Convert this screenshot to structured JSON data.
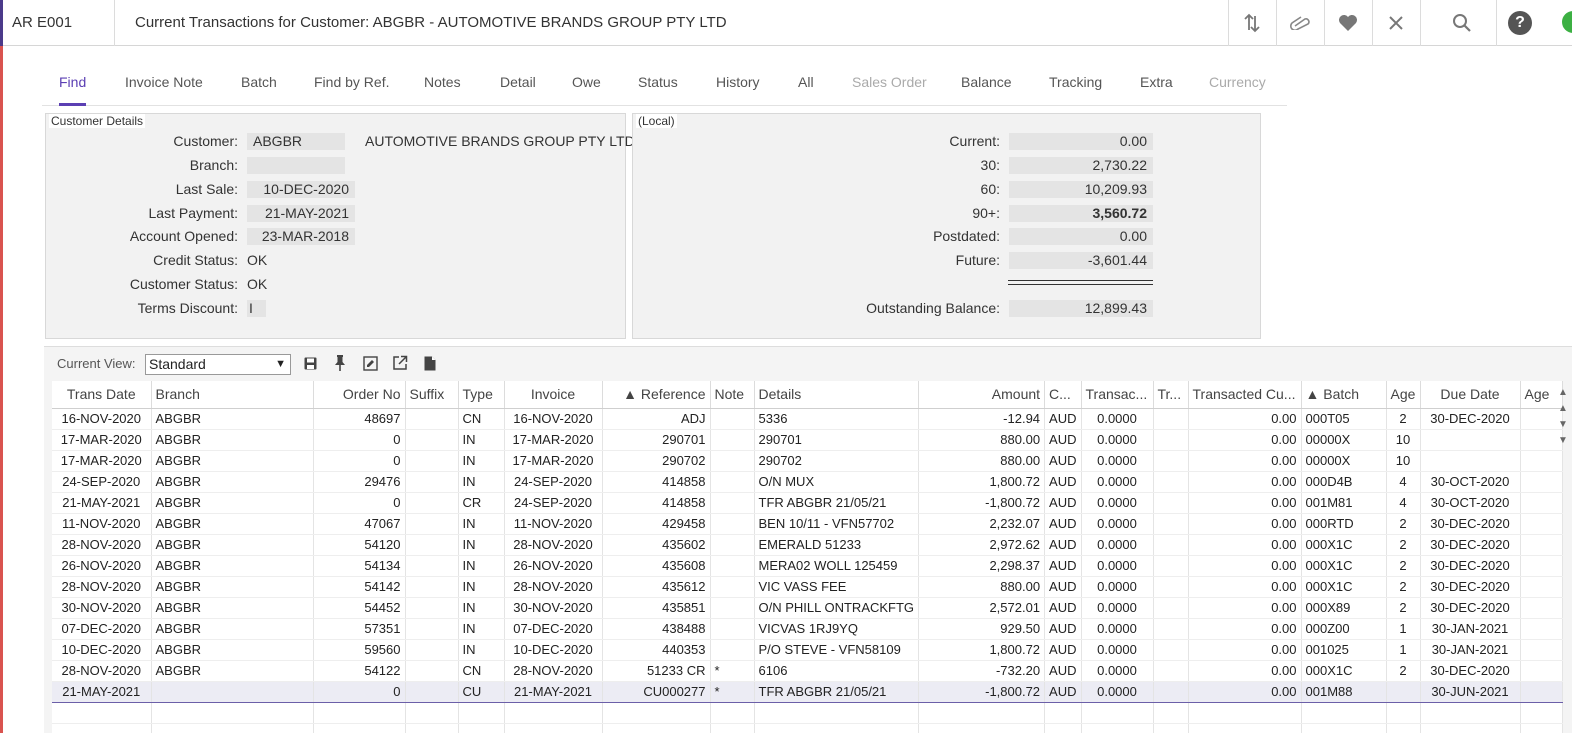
{
  "header": {
    "program_code": "AR E001",
    "title": "Current Transactions for Customer: ABGBR - AUTOMOTIVE BRANDS GROUP PTY LTD",
    "icons": [
      "sort-icon",
      "attachment-icon",
      "favorite-icon",
      "close-icon",
      "search-icon",
      "help-icon"
    ],
    "help_glyph": "?"
  },
  "tabs": [
    {
      "label": "Find",
      "state": "active"
    },
    {
      "label": "Invoice Note",
      "state": "normal"
    },
    {
      "label": "Batch",
      "state": "normal"
    },
    {
      "label": "Find by Ref.",
      "state": "normal"
    },
    {
      "label": "Notes",
      "state": "normal"
    },
    {
      "label": "Detail",
      "state": "normal"
    },
    {
      "label": "Owe",
      "state": "normal"
    },
    {
      "label": "Status",
      "state": "normal"
    },
    {
      "label": "History",
      "state": "normal"
    },
    {
      "label": "All",
      "state": "normal"
    },
    {
      "label": "Sales Order",
      "state": "disabled"
    },
    {
      "label": "Balance",
      "state": "normal"
    },
    {
      "label": "Tracking",
      "state": "normal"
    },
    {
      "label": "Extra",
      "state": "normal"
    },
    {
      "label": "Currency",
      "state": "disabled"
    }
  ],
  "customer_details": {
    "caption": "Customer Details",
    "customer_label": "Customer:",
    "customer_code": "ABGBR",
    "customer_name": "AUTOMOTIVE BRANDS GROUP PTY LTD",
    "branch_label": "Branch:",
    "branch": "",
    "last_sale_label": "Last Sale:",
    "last_sale": "10-DEC-2020",
    "last_payment_label": "Last Payment:",
    "last_payment": "21-MAY-2021",
    "account_opened_label": "Account Opened:",
    "account_opened": "23-MAR-2018",
    "credit_status_label": "Credit Status:",
    "credit_status": "OK",
    "customer_status_label": "Customer Status:",
    "customer_status": "OK",
    "terms_discount_label": "Terms Discount:",
    "terms_discount": "I"
  },
  "aging": {
    "caption": "(Local)",
    "current_label": "Current:",
    "current": "0.00",
    "d30_label": "30:",
    "d30": "2,730.22",
    "d60_label": "60:",
    "d60": "10,209.93",
    "d90_label": "90+:",
    "d90": "3,560.72",
    "postdated_label": "Postdated:",
    "postdated": "0.00",
    "future_label": "Future:",
    "future": "-3,601.44",
    "outstanding_label": "Outstanding Balance:",
    "outstanding": "12,899.43"
  },
  "view": {
    "label": "Current View:",
    "selected": "Standard",
    "tool_icons": [
      "save-icon",
      "pin-icon",
      "edit-view-icon",
      "export-icon",
      "document-icon"
    ]
  },
  "grid": {
    "columns": [
      "Trans Date",
      "Branch",
      "Order No",
      "Suffix",
      "Type",
      "Invoice",
      "▲ Reference",
      "Note",
      "Details",
      "Amount",
      "C...",
      "Transac...",
      "Tr...",
      "Transacted Cu...",
      "▲ Batch",
      "Age",
      "Due Date",
      "Age"
    ],
    "rows": [
      [
        "16-NOV-2020",
        "ABGBR",
        "48697",
        "",
        "CN",
        "16-NOV-2020",
        "ADJ",
        "",
        "5336",
        "-12.94",
        "AUD",
        "0.0000",
        "",
        "0.00",
        "000T05",
        "2",
        "30-DEC-2020",
        ""
      ],
      [
        "17-MAR-2020",
        "ABGBR",
        "0",
        "",
        "IN",
        "17-MAR-2020",
        "290701",
        "",
        "290701",
        "880.00",
        "AUD",
        "0.0000",
        "",
        "0.00",
        "00000X",
        "10",
        "",
        ""
      ],
      [
        "17-MAR-2020",
        "ABGBR",
        "0",
        "",
        "IN",
        "17-MAR-2020",
        "290702",
        "",
        "290702",
        "880.00",
        "AUD",
        "0.0000",
        "",
        "0.00",
        "00000X",
        "10",
        "",
        ""
      ],
      [
        "24-SEP-2020",
        "ABGBR",
        "29476",
        "",
        "IN",
        "24-SEP-2020",
        "414858",
        "",
        "O/N MUX",
        "1,800.72",
        "AUD",
        "0.0000",
        "",
        "0.00",
        "000D4B",
        "4",
        "30-OCT-2020",
        ""
      ],
      [
        "21-MAY-2021",
        "ABGBR",
        "0",
        "",
        "CR",
        "24-SEP-2020",
        "414858",
        "",
        "TFR ABGBR 21/05/21",
        "-1,800.72",
        "AUD",
        "0.0000",
        "",
        "0.00",
        "001M81",
        "4",
        "30-OCT-2020",
        ""
      ],
      [
        "11-NOV-2020",
        "ABGBR",
        "47067",
        "",
        "IN",
        "11-NOV-2020",
        "429458",
        "",
        "BEN 10/11 - VFN57702",
        "2,232.07",
        "AUD",
        "0.0000",
        "",
        "0.00",
        "000RTD",
        "2",
        "30-DEC-2020",
        ""
      ],
      [
        "28-NOV-2020",
        "ABGBR",
        "54120",
        "",
        "IN",
        "28-NOV-2020",
        "435602",
        "",
        "EMERALD 51233",
        "2,972.62",
        "AUD",
        "0.0000",
        "",
        "0.00",
        "000X1C",
        "2",
        "30-DEC-2020",
        ""
      ],
      [
        "26-NOV-2020",
        "ABGBR",
        "54134",
        "",
        "IN",
        "26-NOV-2020",
        "435608",
        "",
        "MERA02  WOLL 125459",
        "2,298.37",
        "AUD",
        "0.0000",
        "",
        "0.00",
        "000X1C",
        "2",
        "30-DEC-2020",
        ""
      ],
      [
        "28-NOV-2020",
        "ABGBR",
        "54142",
        "",
        "IN",
        "28-NOV-2020",
        "435612",
        "",
        "VIC VASS FEE",
        "880.00",
        "AUD",
        "0.0000",
        "",
        "0.00",
        "000X1C",
        "2",
        "30-DEC-2020",
        ""
      ],
      [
        "30-NOV-2020",
        "ABGBR",
        "54452",
        "",
        "IN",
        "30-NOV-2020",
        "435851",
        "",
        "O/N PHILL ONTRACKFTG",
        "2,572.01",
        "AUD",
        "0.0000",
        "",
        "0.00",
        "000X89",
        "2",
        "30-DEC-2020",
        ""
      ],
      [
        "07-DEC-2020",
        "ABGBR",
        "57351",
        "",
        "IN",
        "07-DEC-2020",
        "438488",
        "",
        "VICVAS 1RJ9YQ",
        "929.50",
        "AUD",
        "0.0000",
        "",
        "0.00",
        "000Z00",
        "1",
        "30-JAN-2021",
        ""
      ],
      [
        "10-DEC-2020",
        "ABGBR",
        "59560",
        "",
        "IN",
        "10-DEC-2020",
        "440353",
        "",
        "P/O STEVE - VFN58109",
        "1,800.72",
        "AUD",
        "0.0000",
        "",
        "0.00",
        "001025",
        "1",
        "30-JAN-2021",
        ""
      ],
      [
        "28-NOV-2020",
        "ABGBR",
        "54122",
        "",
        "CN",
        "28-NOV-2020",
        "51233 CR",
        "*",
        "6106",
        "-732.20",
        "AUD",
        "0.0000",
        "",
        "0.00",
        "000X1C",
        "2",
        "30-DEC-2020",
        ""
      ],
      [
        "21-MAY-2021",
        "",
        "0",
        "",
        "CU",
        "21-MAY-2021",
        "CU000277",
        "*",
        "TFR ABGBR 21/05/21",
        "-1,800.72",
        "AUD",
        "0.0000",
        "",
        "0.00",
        "001M88",
        "",
        "30-JUN-2021",
        ""
      ]
    ],
    "selected_row": 13
  },
  "colors": {
    "accent": "#5b3fb3",
    "left_bar": "#d9534f",
    "status_dot": "#3cb043"
  }
}
